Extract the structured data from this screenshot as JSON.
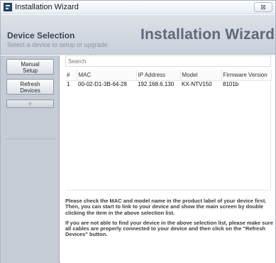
{
  "window": {
    "title": "Installation Wizard",
    "close_label": "⊠"
  },
  "header": {
    "title": "Device Selection",
    "subtitle": "Select a device to setup or upgrade",
    "brand": "Installation Wizard"
  },
  "sidebar": {
    "manual_setup_line1": "Manual",
    "manual_setup_line2": "Setup",
    "refresh_line1": "Refresh",
    "refresh_line2": "Devices",
    "extra_glyph": "▼"
  },
  "search": {
    "placeholder": "Search"
  },
  "table": {
    "columns": [
      "#",
      "MAC",
      "IP Address",
      "Model",
      "Firmware Version"
    ],
    "rows": [
      {
        "index": "1",
        "mac": "00-02-D1-3B-64-28",
        "ip": "192.168.6.130",
        "model": "KX-NTV150",
        "firmware": "8101b"
      }
    ]
  },
  "info": {
    "paragraph1": "Please check the MAC and model name in the product label of your device first. Then, you can start to link to your device and show the main screen by double clicking the item in the above selection list.",
    "paragraph2": "If you are not able to find your device in the above selection list, please make sure all cables are properly connected to your device and then click on the \"Refresh Devices\" button."
  },
  "colors": {
    "header_bg": "#d3d9e0",
    "sidebar_bg": "#c5ccd5",
    "brand_text": "#5d6a7a"
  }
}
